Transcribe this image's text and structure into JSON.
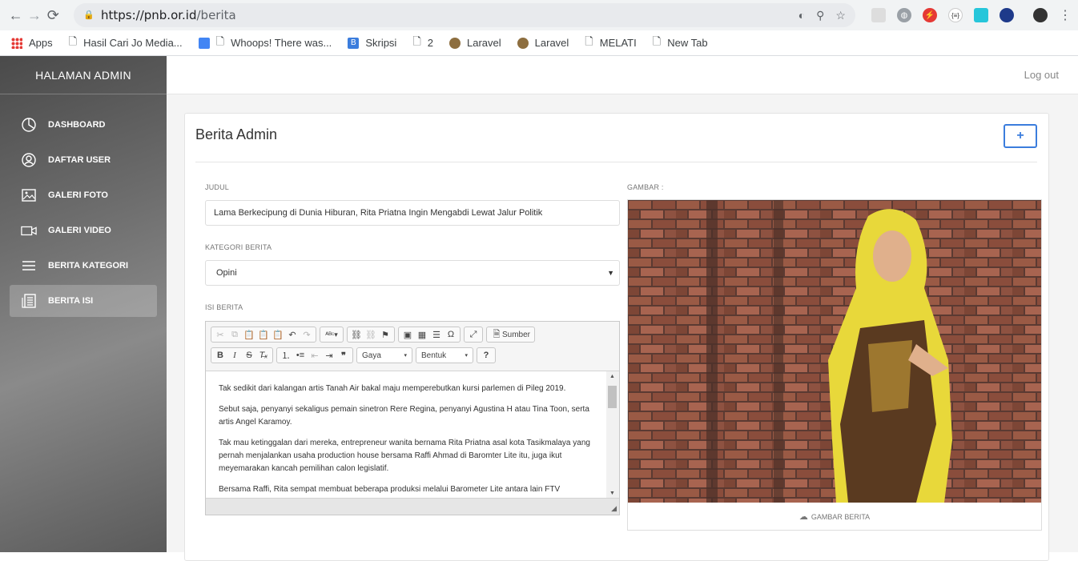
{
  "browser": {
    "url_host": "https://pnb.or.id",
    "url_path": "/berita",
    "bookmarks": [
      "Apps",
      "Hasil Cari Jo Media...",
      "Whoops! There was...",
      "Skripsi",
      "2",
      "Laravel",
      "Laravel",
      "MELATI",
      "New Tab"
    ]
  },
  "sidebar": {
    "title": "HALAMAN ADMIN",
    "items": [
      {
        "label": "DASHBOARD",
        "icon": "dashboard-icon"
      },
      {
        "label": "DAFTAR USER",
        "icon": "user-icon"
      },
      {
        "label": "GALERI FOTO",
        "icon": "image-icon"
      },
      {
        "label": "GALERI VIDEO",
        "icon": "video-icon"
      },
      {
        "label": "BERITA KATEGORI",
        "icon": "list-icon"
      },
      {
        "label": "BERITA ISI",
        "icon": "article-icon"
      }
    ]
  },
  "topbar": {
    "logout": "Log out"
  },
  "card": {
    "title": "Berita Admin",
    "add_label": "+",
    "judul_label": "JUDUL",
    "judul_value": "Lama Berkecipung di Dunia Hiburan, Rita Priatna Ingin Mengabdi Lewat Jalur Politik",
    "kategori_label": "KATEGORI BERITA",
    "kategori_value": "Opini",
    "isi_label": "ISI BERITA",
    "gambar_label": "GAMBAR :",
    "gambar_caption": "GAMBAR BERITA"
  },
  "editor": {
    "source_label": "Sumber",
    "style_label": "Gaya",
    "format_label": "Bentuk",
    "help_label": "?",
    "paragraphs": [
      "Tak sedikit dari kalangan artis Tanah Air bakal maju memperebutkan kursi parlemen di Pileg 2019.",
      "Sebut saja, penyanyi sekaligus pemain sinetron Rere Regina, penyanyi Agustina H atau Tina Toon, serta artis Angel Karamoy.",
      "Tak mau ketinggalan dari mereka, entrepreneur wanita bernama Rita Priatna asal kota Tasikmalaya yang pernah menjalankan usaha production house bersama Raffi Ahmad di Baromter Lite itu, juga ikut meyemarakan kancah pemilihan calon legislatif.",
      "Bersama Raffi, Rita sempat membuat beberapa produksi melalui Barometer Lite antara lain FTV"
    ]
  }
}
